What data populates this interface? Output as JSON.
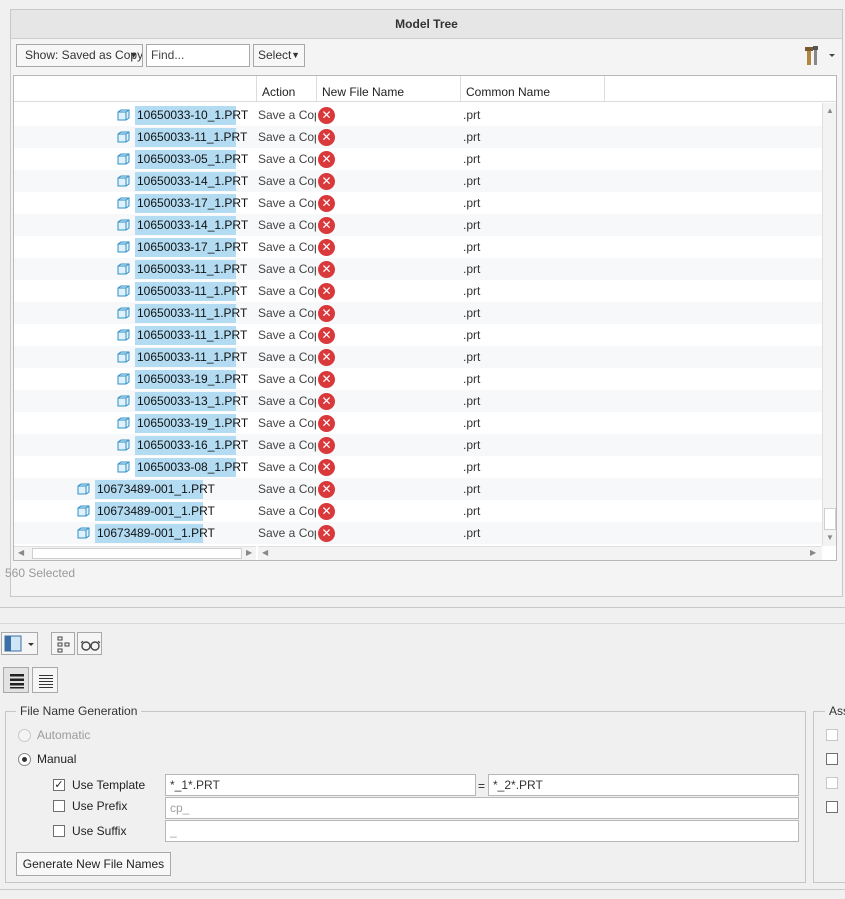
{
  "panel": {
    "title": "Model Tree",
    "show_combo": "Show: Saved as Copy",
    "find_placeholder": "Find...",
    "select_combo": "Select",
    "status": "560 Selected"
  },
  "columns": [
    "Action",
    "New File Name",
    "Common Name"
  ],
  "rows": [
    {
      "name": "10650033-10_1.PRT",
      "action": "Save a Copy",
      "common": ".prt"
    },
    {
      "name": "10650033-11_1.PRT",
      "action": "Save a Copy",
      "common": ".prt"
    },
    {
      "name": "10650033-05_1.PRT",
      "action": "Save a Copy",
      "common": ".prt"
    },
    {
      "name": "10650033-14_1.PRT",
      "action": "Save a Copy",
      "common": ".prt"
    },
    {
      "name": "10650033-17_1.PRT",
      "action": "Save a Copy",
      "common": ".prt"
    },
    {
      "name": "10650033-14_1.PRT",
      "action": "Save a Copy",
      "common": ".prt"
    },
    {
      "name": "10650033-17_1.PRT",
      "action": "Save a Copy",
      "common": ".prt"
    },
    {
      "name": "10650033-11_1.PRT",
      "action": "Save a Copy",
      "common": ".prt"
    },
    {
      "name": "10650033-11_1.PRT",
      "action": "Save a Copy",
      "common": ".prt"
    },
    {
      "name": "10650033-11_1.PRT",
      "action": "Save a Copy",
      "common": ".prt"
    },
    {
      "name": "10650033-11_1.PRT",
      "action": "Save a Copy",
      "common": ".prt"
    },
    {
      "name": "10650033-11_1.PRT",
      "action": "Save a Copy",
      "common": ".prt"
    },
    {
      "name": "10650033-19_1.PRT",
      "action": "Save a Copy",
      "common": ".prt"
    },
    {
      "name": "10650033-13_1.PRT",
      "action": "Save a Copy",
      "common": ".prt"
    },
    {
      "name": "10650033-19_1.PRT",
      "action": "Save a Copy",
      "common": ".prt"
    },
    {
      "name": "10650033-16_1.PRT",
      "action": "Save a Copy",
      "common": ".prt"
    },
    {
      "name": "10650033-08_1.PRT",
      "action": "Save a Copy",
      "common": ".prt"
    },
    {
      "name": "10673489-001_1.PRT",
      "action": "Save a Copy",
      "common": ".prt",
      "level": 1
    },
    {
      "name": "10673489-001_1.PRT",
      "action": "Save a Copy",
      "common": ".prt",
      "level": 1
    },
    {
      "name": "10673489-001_1.PRT",
      "action": "Save a Copy",
      "common": ".prt",
      "level": 1
    }
  ],
  "fng": {
    "legend": "File Name Generation",
    "automatic": "Automatic",
    "manual": "Manual",
    "use_template": "Use Template",
    "use_prefix": "Use Prefix",
    "use_suffix": "Use Suffix",
    "template_from": "*_1*.PRT",
    "equals": "=",
    "template_to": "*_2*.PRT",
    "prefix_value": "cp_",
    "suffix_value": "_",
    "generate_button": "Generate New File Names"
  },
  "assoc": {
    "legend": "Ass"
  },
  "icons": {
    "part": "part-icon",
    "error": "error-icon",
    "tools": "tools-icon"
  },
  "colors": {
    "selection": "#b3dcf3",
    "error": "#d9393b"
  }
}
